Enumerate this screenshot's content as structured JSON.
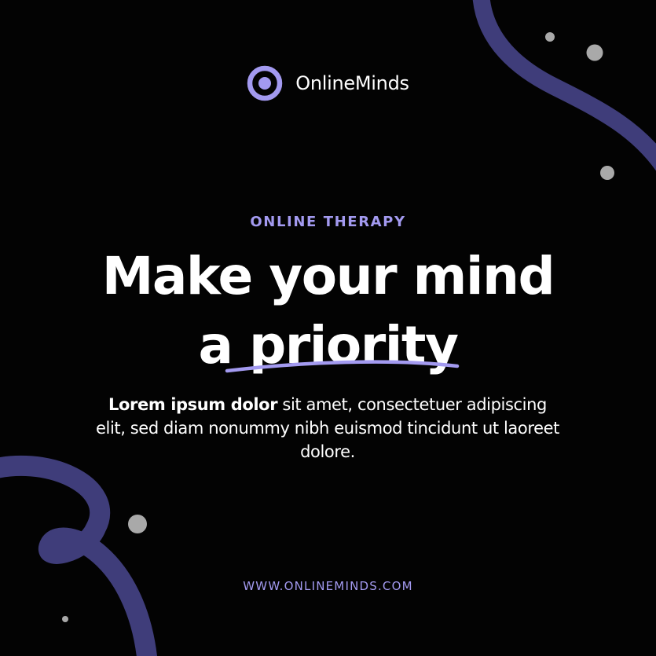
{
  "brand": {
    "name": "OnlineMinds",
    "logo_icon": "target-ring-icon"
  },
  "hero": {
    "eyebrow": "ONLINE THERAPY",
    "headline_line1": "Make your mind",
    "headline_line2_prefix": "a ",
    "headline_line2_highlight": "priority"
  },
  "body": {
    "bold_lead": "Lorem ipsum dolor",
    "rest": " sit amet, consectetuer adipiscing elit, sed diam nonummy nibh euismod tincidunt ut laoreet dolore."
  },
  "footer": {
    "url": "WWW.ONLINEMINDS.COM"
  },
  "colors": {
    "background": "#030303",
    "accent": "#a39af0",
    "swirl": "#3f3d7a",
    "dot": "#a9a9a9",
    "text": "#ffffff"
  },
  "decorations": {
    "top_right": "swirl-ribbon",
    "bottom_left": "loop-ribbon",
    "dots": "grey-dots"
  }
}
